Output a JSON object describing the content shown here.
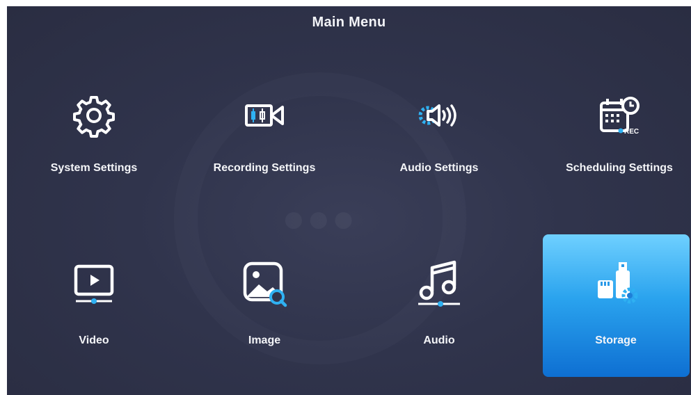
{
  "header": {
    "title": "Main Menu"
  },
  "menu": {
    "items": [
      {
        "label": "System Settings",
        "icon": "gear-icon"
      },
      {
        "label": "Recording Settings",
        "icon": "video-camera-icon"
      },
      {
        "label": "Audio Settings",
        "icon": "speaker-gear-icon"
      },
      {
        "label": "Scheduling Settings",
        "icon": "calendar-clock-rec-icon"
      },
      {
        "label": "Video",
        "icon": "video-player-icon"
      },
      {
        "label": "Image",
        "icon": "image-search-icon"
      },
      {
        "label": "Audio",
        "icon": "music-note-icon"
      },
      {
        "label": "Storage",
        "icon": "storage-usb-icon",
        "selected": true
      }
    ],
    "rec_badge": "REC"
  },
  "colors": {
    "background": "#30344c",
    "selected_top": "#6fd0ff",
    "selected_bottom": "#0e6fd2",
    "accent": "#2fb1f2",
    "text": "#f4f5f8"
  }
}
